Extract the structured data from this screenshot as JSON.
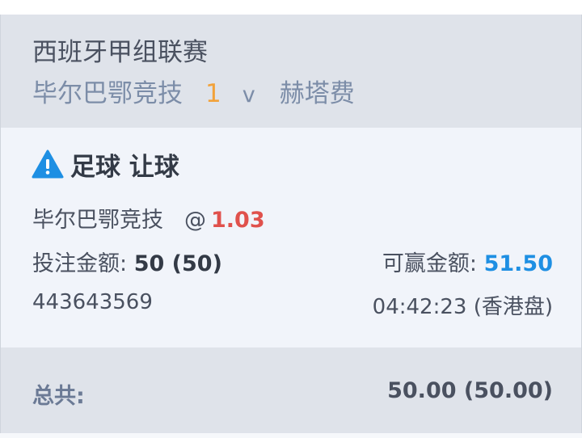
{
  "header": {
    "league": "西班牙甲组联赛",
    "home_team": "毕尔巴鄂竞技",
    "score": "1",
    "vs": "v",
    "away_team": "赫塔费"
  },
  "bet": {
    "title": "足球 让球",
    "selection": "毕尔巴鄂竞技",
    "at": "@",
    "odds": "1.03",
    "stake_label": "投注金额:",
    "stake_value": "50 (50)",
    "win_label": "可赢金额:",
    "win_value": "51.50",
    "ticket_id": "443643569",
    "time": "04:42:23 (香港盘)",
    "icon": "warning-icon"
  },
  "footer": {
    "total_label": "总共:",
    "total_value": "50.00 (50.00)"
  },
  "colors": {
    "score": "#f2a23a",
    "odds": "#e0514c",
    "win_value": "#1e8fe3",
    "warning": "#1e8fe3"
  }
}
